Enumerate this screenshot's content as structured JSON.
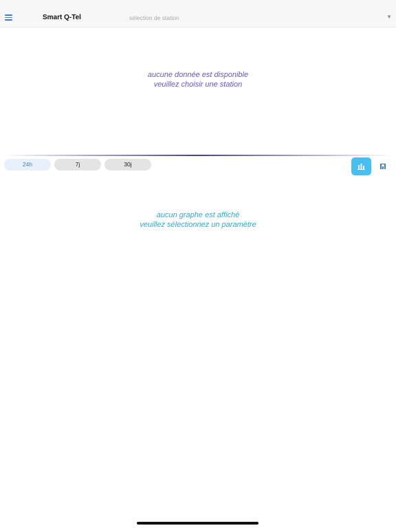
{
  "header": {
    "title": "Smart Q-Tel",
    "station_select": {
      "placeholder": "sélection de station"
    }
  },
  "messages": {
    "no_data_line1": "aucune donnée est disponible",
    "no_data_line2": "veuillez choisir une station",
    "no_graph_line1": "aucun graphe est affiché",
    "no_graph_line2": "veuillez sélectionnez un paramètre"
  },
  "periods": [
    {
      "label": "24h",
      "selected": true
    },
    {
      "label": "7j",
      "selected": false
    },
    {
      "label": "30j",
      "selected": false
    }
  ],
  "view_toggle": {
    "selected": "bar-chart"
  },
  "icons": {
    "menu": "hamburger-menu-icon",
    "caret": "chevron-down-icon",
    "bar_chart": "bar-chart-icon",
    "table": "table-chart-icon"
  },
  "colors": {
    "accent_blue": "#3a7bd5",
    "message_purple": "#6a56c9",
    "message_cyan": "#33a6cf",
    "toggle_active": "#46c0f0"
  }
}
